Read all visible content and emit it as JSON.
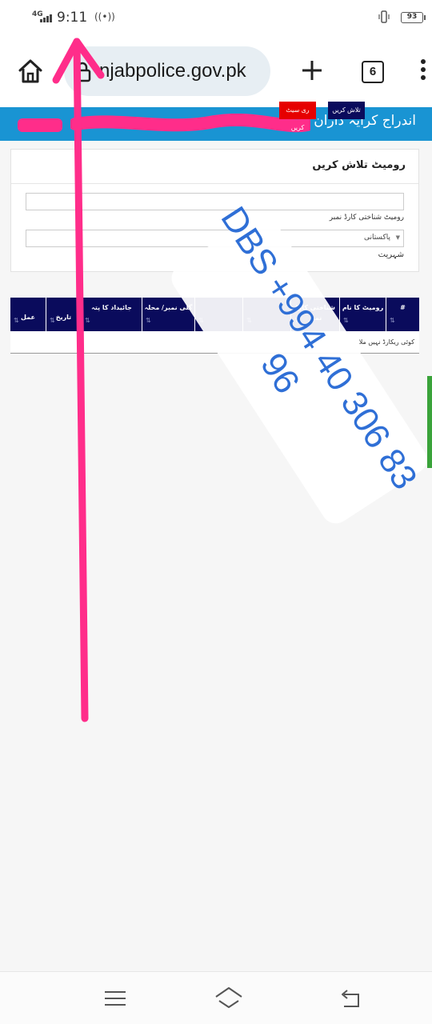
{
  "status_bar": {
    "network": "4G",
    "time": "9:11",
    "battery": "93"
  },
  "browser": {
    "url": "njabpolice.gov.pk",
    "tab_count": "6"
  },
  "site": {
    "title": "اندراج کرایہ داران سسٹم"
  },
  "search_card": {
    "title": "روميٹ تلاش کریں",
    "cnic_label": "روميٹ شناختی کارڈ نمبر",
    "nationality_value": "پاکستانی",
    "nationality_label": "شہریت",
    "search_button": "تلاش کریں",
    "reset_button": "ری سیٹ کریں"
  },
  "table": {
    "columns": [
      "#",
      "روميٹ کا نام",
      "شناختی کارڈ نمبر",
      "",
      "",
      "گلی نمبر/ محلہ",
      "جائیداد کا پتہ",
      "تاریخ",
      "عمل"
    ],
    "empty_message": "کوئی ریکارڈ نہیں ملا"
  },
  "watermark": {
    "line1": "DBS +994 40 306 83",
    "line2": "96"
  },
  "colors": {
    "header_blue": "#1994d3",
    "navy": "#0a0b5c",
    "reset_red": "#e60000",
    "annotation_pink": "#ff2d8a",
    "watermark_blue": "#2f6fd6"
  }
}
